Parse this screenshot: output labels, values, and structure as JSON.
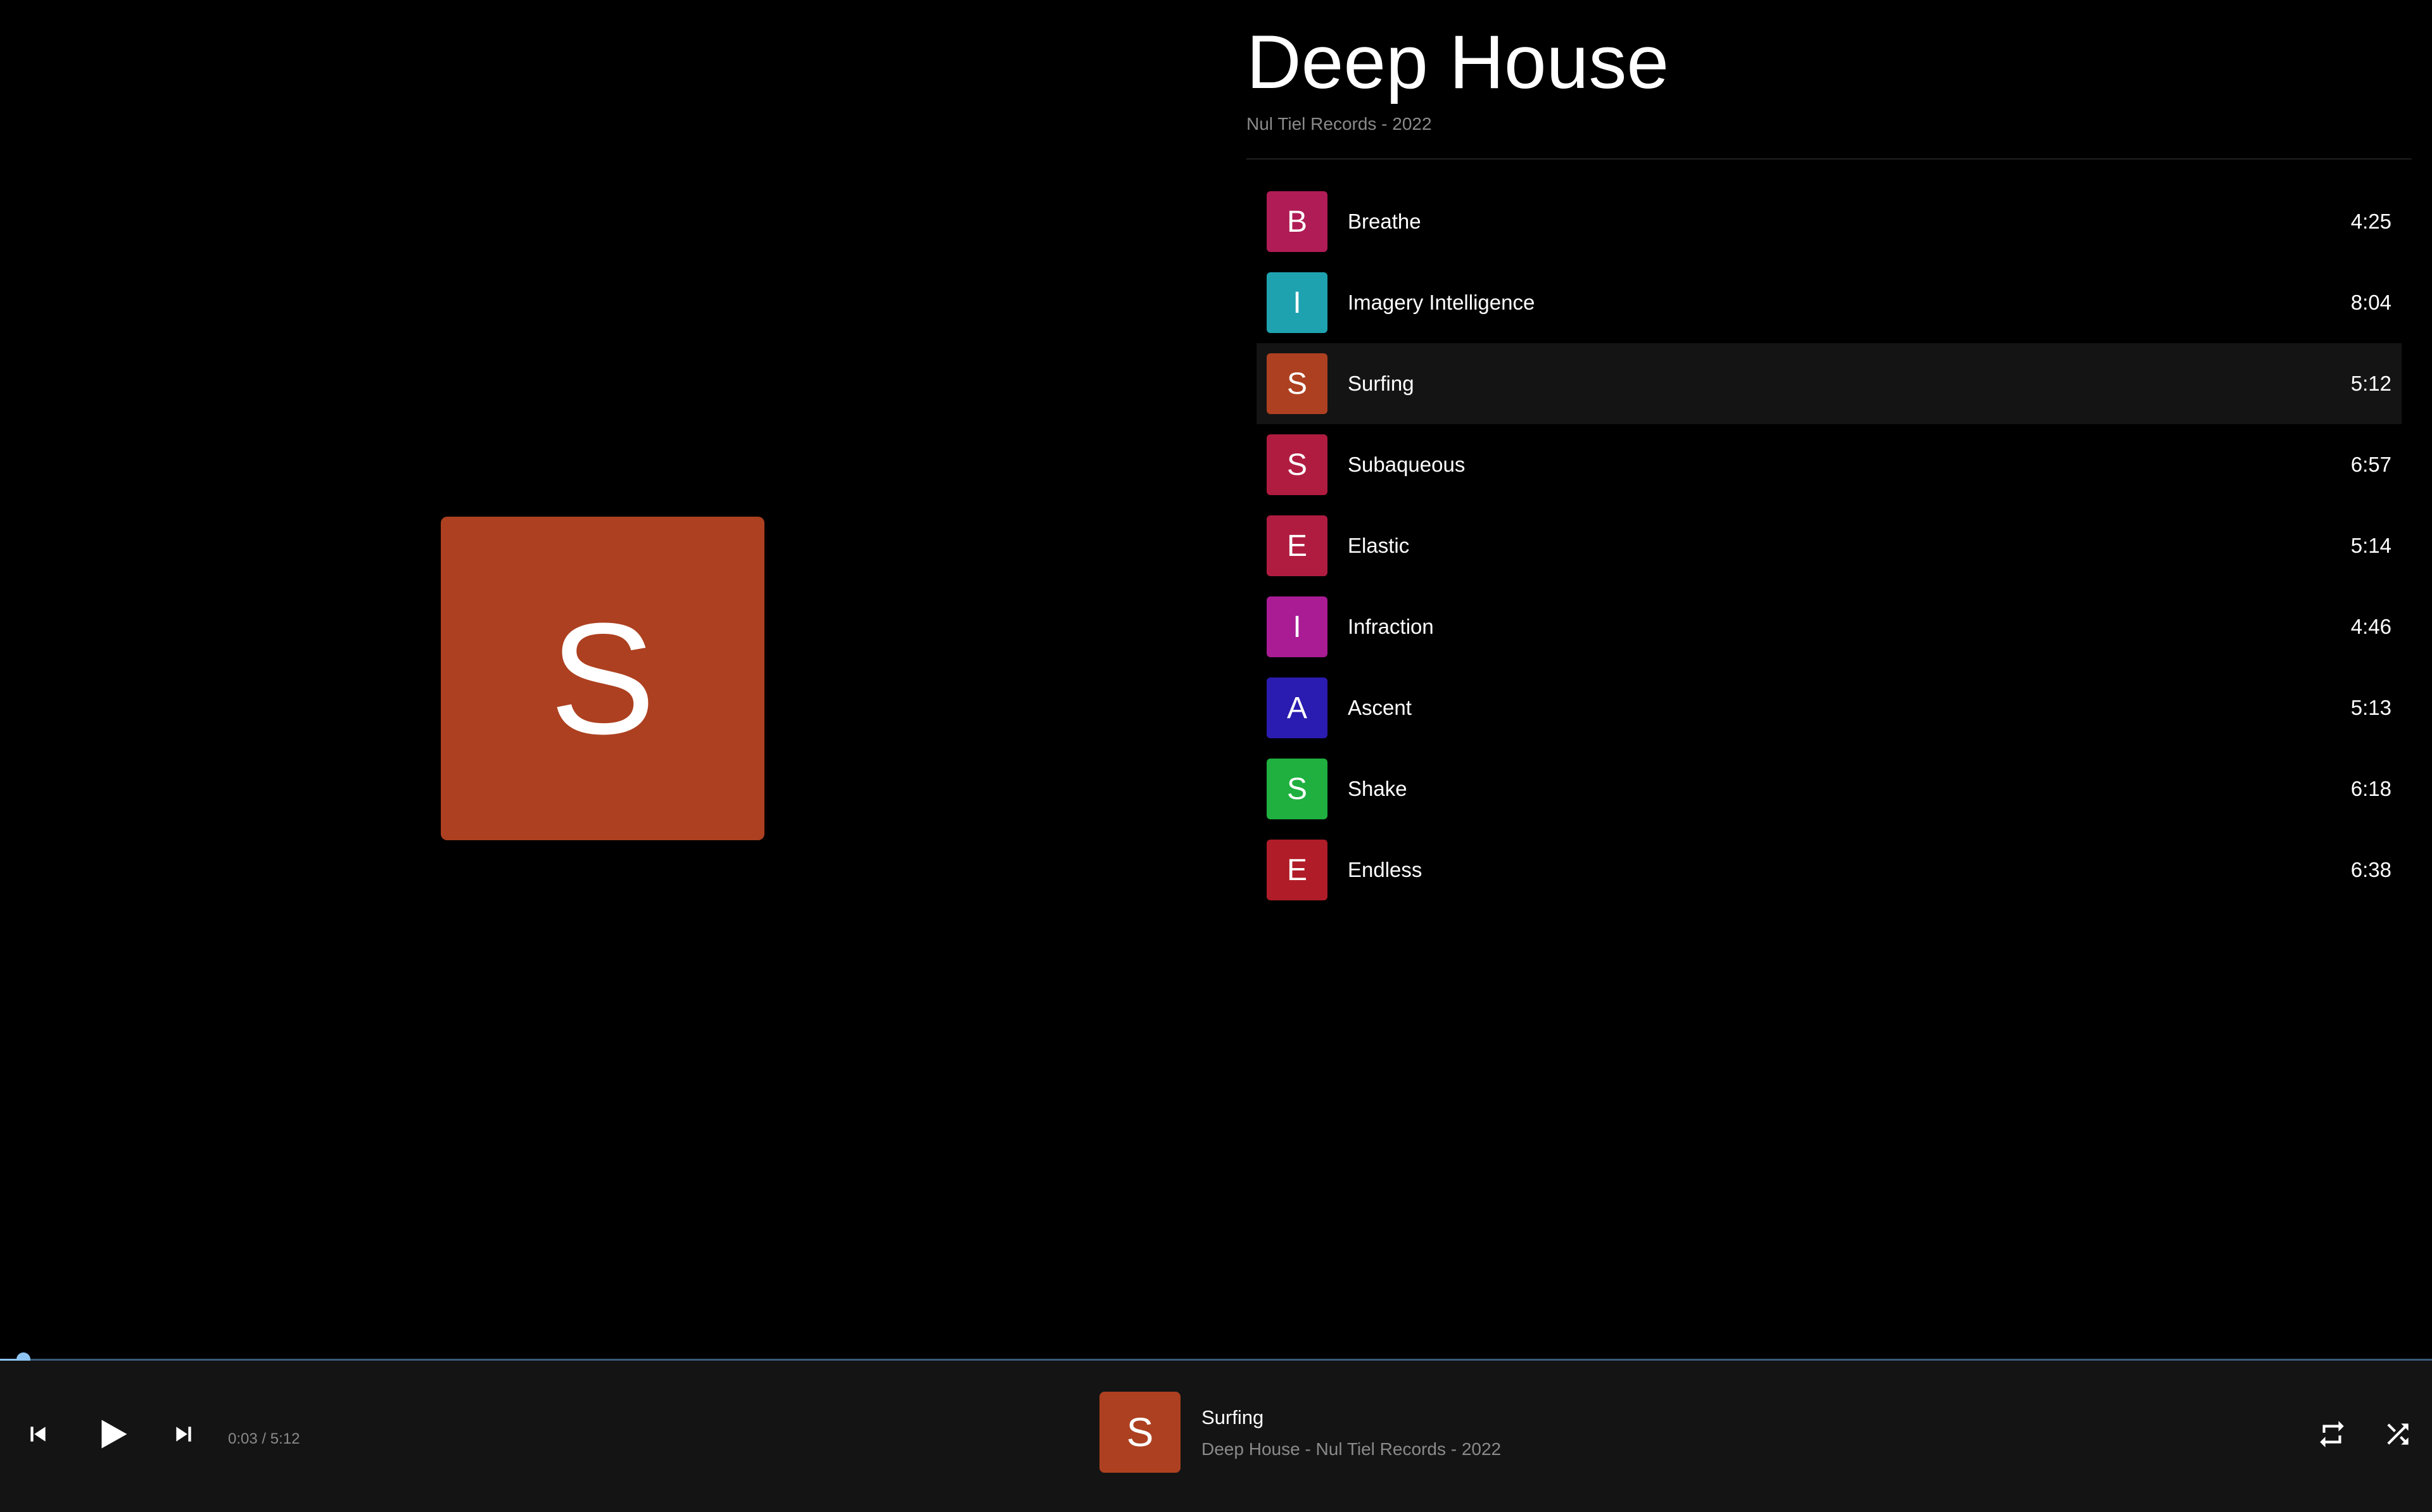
{
  "album": {
    "title": "Deep House",
    "subtitle": "Nul Tiel Records - 2022"
  },
  "artwork": {
    "letter": "S",
    "color": "#ad4020"
  },
  "tracks": [
    {
      "letter": "B",
      "title": "Breathe",
      "duration": "4:25",
      "color": "#b01c55"
    },
    {
      "letter": "I",
      "title": "Imagery Intelligence",
      "duration": "8:04",
      "color": "#1fa2b0"
    },
    {
      "letter": "S",
      "title": "Surfing",
      "duration": "5:12",
      "color": "#ad4020",
      "active": true
    },
    {
      "letter": "S",
      "title": "Subaqueous",
      "duration": "6:57",
      "color": "#b01c40"
    },
    {
      "letter": "E",
      "title": "Elastic",
      "duration": "5:14",
      "color": "#b01c40"
    },
    {
      "letter": "I",
      "title": "Infraction",
      "duration": "4:46",
      "color": "#a91c94"
    },
    {
      "letter": "A",
      "title": "Ascent",
      "duration": "5:13",
      "color": "#2a1cb0"
    },
    {
      "letter": "S",
      "title": "Shake",
      "duration": "6:18",
      "color": "#1fb040"
    },
    {
      "letter": "E",
      "title": "Endless",
      "duration": "6:38",
      "color": "#b01c28"
    }
  ],
  "player": {
    "time": "0:03 / 5:12",
    "progress_fraction": 0.0096,
    "now_letter": "S",
    "now_title": "Surfing",
    "now_subtitle": "Deep House - Nul Tiel Records - 2022",
    "now_color": "#ad4020",
    "icons": {
      "prev": "skip-previous-icon",
      "play": "play-icon",
      "next": "skip-next-icon",
      "repeat": "repeat-icon",
      "shuffle": "shuffle-icon"
    }
  }
}
